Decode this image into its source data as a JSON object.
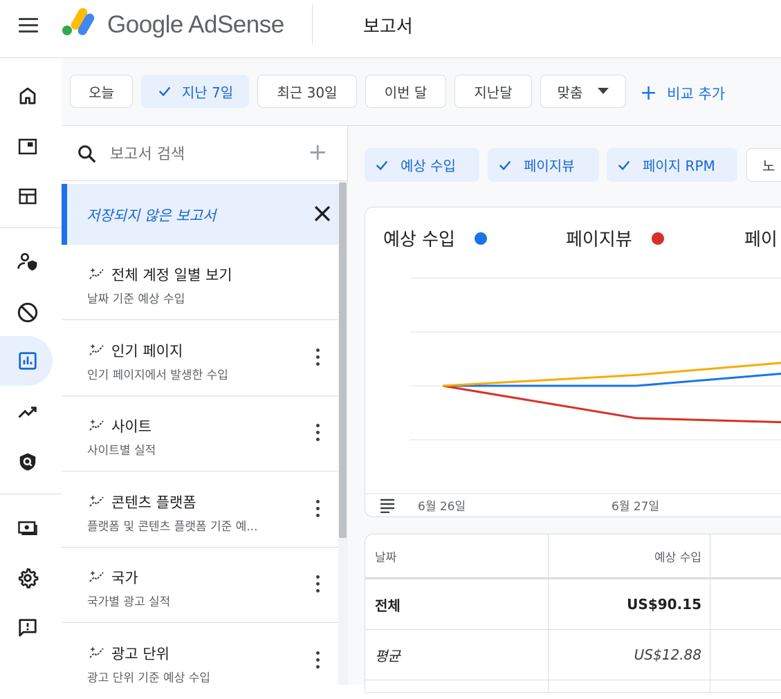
{
  "app": {
    "brand": "Google AdSense",
    "page_title": "보고서"
  },
  "date_filters": [
    {
      "label": "오늘",
      "selected": false
    },
    {
      "label": "지난 7일",
      "selected": true
    },
    {
      "label": "최근 30일",
      "selected": false
    },
    {
      "label": "이번 달",
      "selected": false
    },
    {
      "label": "지난달",
      "selected": false
    },
    {
      "label": "맞춤",
      "selected": false
    }
  ],
  "add_compare_label": "비교 추가",
  "search": {
    "placeholder": "보고서 검색"
  },
  "unsaved_report": {
    "label": "저장되지 않은 보고서"
  },
  "reports": [
    {
      "title": "전체 계정 일별 보기",
      "subtitle": "날짜 기준 예상 수입"
    },
    {
      "title": "인기 페이지",
      "subtitle": "인기 페이지에서 발생한 수입"
    },
    {
      "title": "사이트",
      "subtitle": "사이트별 실적"
    },
    {
      "title": "콘텐츠 플랫폼",
      "subtitle": "플랫폼 및 콘텐츠 플랫폼 기준 예..."
    },
    {
      "title": "국가",
      "subtitle": "국가별 광고 실적"
    },
    {
      "title": "광고 단위",
      "subtitle": "광고 단위 기준 예상 수입"
    }
  ],
  "metric_chips": [
    {
      "label": "예상 수입",
      "selected": true
    },
    {
      "label": "페이지뷰",
      "selected": true
    },
    {
      "label": "페이지 RPM",
      "selected": true
    },
    {
      "label": "노",
      "selected": false
    }
  ],
  "chart_data": {
    "type": "line",
    "x": [
      "6월 26일",
      "6월 27일",
      ""
    ],
    "legend": [
      {
        "name": "예상 수입",
        "color": "#1a73e8"
      },
      {
        "name": "페이지뷰",
        "color": "#d93025"
      },
      {
        "name": "페이",
        "color": "#f9ab00"
      }
    ],
    "series": [
      {
        "name": "예상 수입",
        "color": "#1a73e8",
        "values": [
          0,
          0,
          0.3
        ]
      },
      {
        "name": "페이지뷰",
        "color": "#d93025",
        "values": [
          0,
          -0.6,
          -0.7
        ]
      },
      {
        "name": "페이",
        "color": "#f9ab00",
        "values": [
          0,
          0.2,
          0.5
        ]
      }
    ],
    "grid": true
  },
  "table": {
    "headers": [
      "날짜",
      "예상 수입"
    ],
    "rows": [
      {
        "label": "전체",
        "value": "US$90.15"
      },
      {
        "label": "평균",
        "value": "US$12.88"
      }
    ]
  },
  "colors": {
    "accent": "#1a73e8",
    "selected_bg": "#e8f0fe"
  }
}
